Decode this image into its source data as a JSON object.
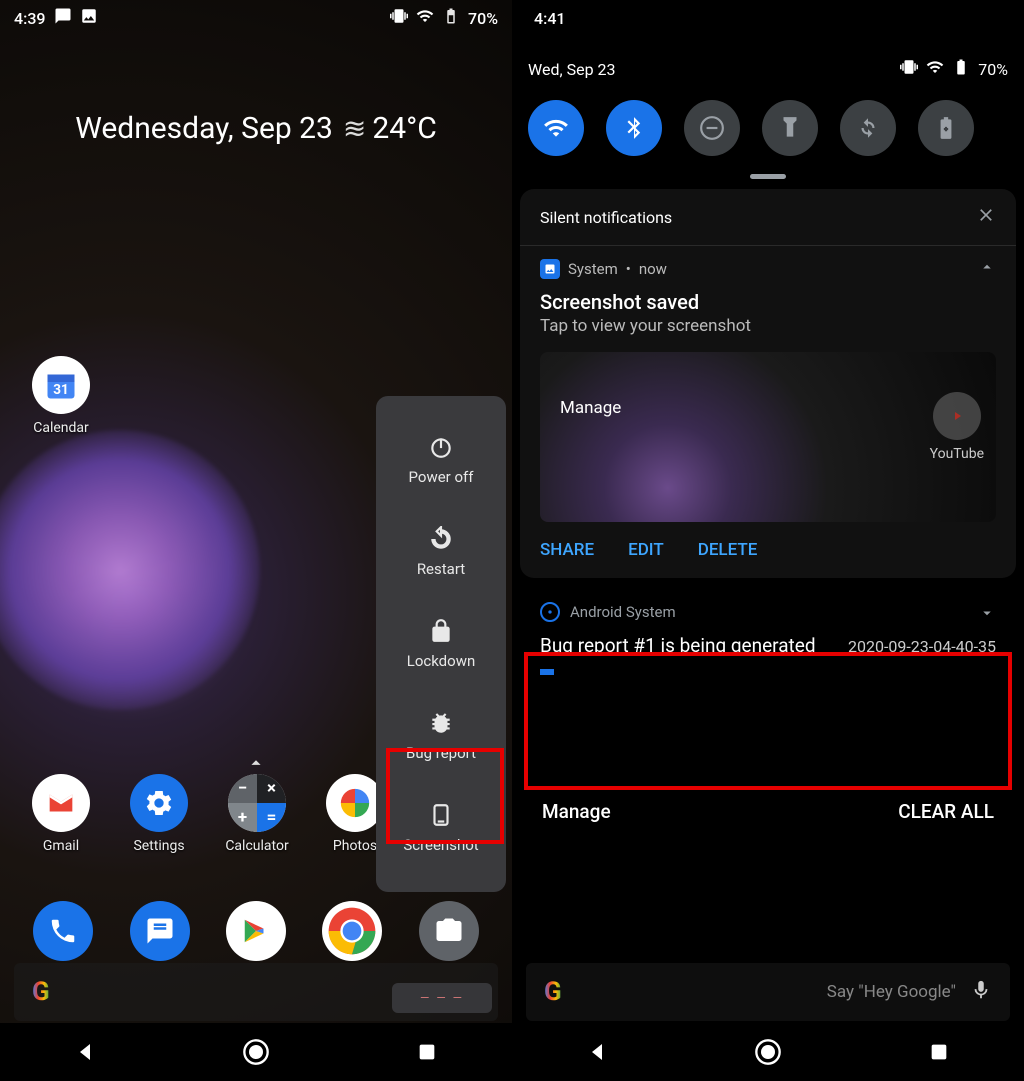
{
  "left": {
    "status": {
      "time": "4:39",
      "battery": "70%"
    },
    "widget": {
      "date": "Wednesday, Sep 23",
      "temp": "24°C"
    },
    "apps": {
      "calendar": "Calendar",
      "gmail": "Gmail",
      "settings": "Settings",
      "calculator": "Calculator",
      "photos": "Photos"
    },
    "powermenu": {
      "poweroff": "Power off",
      "restart": "Restart",
      "lockdown": "Lockdown",
      "bugreport": "Bug report",
      "screenshot": "Screenshot"
    }
  },
  "right": {
    "status": {
      "time": "4:41",
      "date": "Wed, Sep 23",
      "battery": "70%"
    },
    "silent_header": "Silent notifications",
    "screenshot_notif": {
      "source": "System",
      "when": "now",
      "title": "Screenshot saved",
      "subtitle": "Tap to view your screenshot",
      "thumb_manage": "Manage",
      "thumb_youtube": "YouTube",
      "share": "SHARE",
      "edit": "EDIT",
      "delete": "DELETE"
    },
    "system_notif": {
      "source": "Android System",
      "title": "Bug report #1 is being generated",
      "timestamp": "2020-09-23-04-40-35"
    },
    "footer": {
      "manage": "Manage",
      "clear": "CLEAR ALL"
    },
    "search_hint": "Say \"Hey Google\""
  }
}
